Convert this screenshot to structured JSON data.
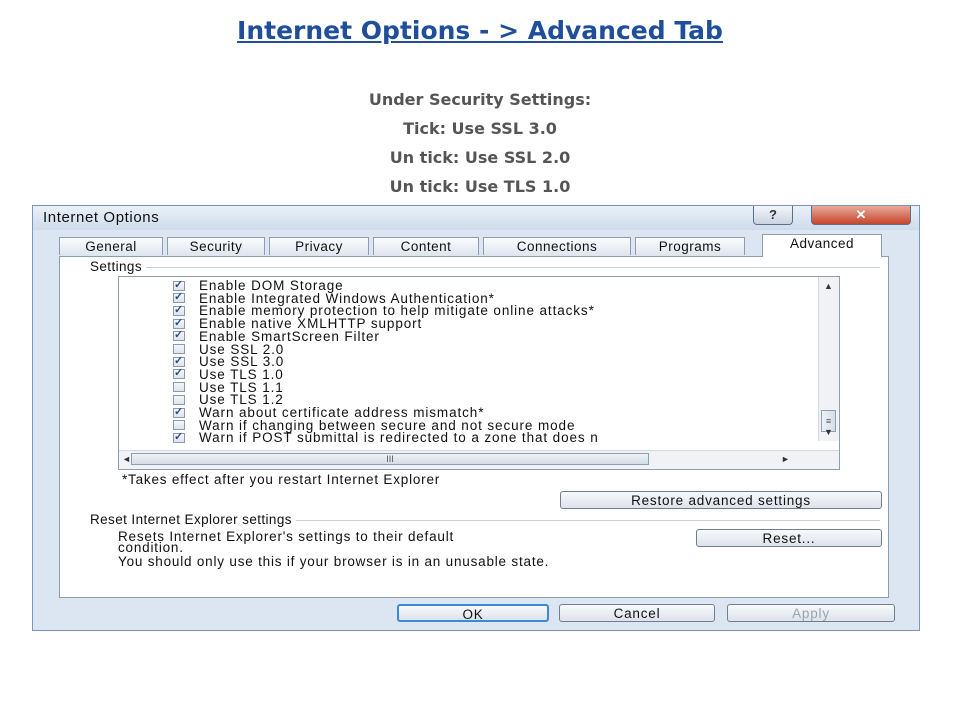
{
  "slide": {
    "title": "Internet Options  - >  Advanced Tab",
    "instructions": [
      "Under Security Settings:",
      "Tick: Use SSL 3.0",
      "Un tick: Use SSL 2.0",
      "Un tick: Use TLS 1.0"
    ]
  },
  "dialog": {
    "title": "Internet Options",
    "help_label": "?",
    "close_label": "✕",
    "tabs": [
      "General",
      "Security",
      "Privacy",
      "Content",
      "Connections",
      "Programs",
      "Advanced"
    ],
    "active_tab": "Advanced",
    "settings_label": "Settings",
    "settings_items": [
      {
        "label": "Enable DOM Storage",
        "checked": true
      },
      {
        "label": "Enable Integrated Windows Authentication*",
        "checked": true
      },
      {
        "label": "Enable memory protection to help mitigate online attacks*",
        "checked": true
      },
      {
        "label": "Enable native XMLHTTP support",
        "checked": true
      },
      {
        "label": "Enable SmartScreen Filter",
        "checked": true
      },
      {
        "label": "Use SSL 2.0",
        "checked": false
      },
      {
        "label": "Use SSL 3.0",
        "checked": true
      },
      {
        "label": "Use TLS 1.0",
        "checked": true
      },
      {
        "label": "Use TLS 1.1",
        "checked": false
      },
      {
        "label": "Use TLS 1.2",
        "checked": false
      },
      {
        "label": "Warn about certificate address mismatch*",
        "checked": true
      },
      {
        "label": "Warn if changing between secure and not secure mode",
        "checked": false
      },
      {
        "label": "Warn if POST submittal is redirected to a zone that does n",
        "checked": true
      }
    ],
    "restart_note": "*Takes effect after you restart Internet Explorer",
    "restore_button": "Restore advanced settings",
    "reset_group_label": "Reset Internet Explorer settings",
    "reset_desc_line1": "Resets Internet Explorer's settings to their default",
    "reset_desc_line2": "condition.",
    "reset_button": "Reset...",
    "reset_warning": "You should only use this if your browser is in an unusable state.",
    "ok_button": "OK",
    "cancel_button": "Cancel",
    "apply_button": "Apply",
    "scroll_glyph_up": "▲",
    "scroll_glyph_down": "▼",
    "scroll_glyph_left": "◄",
    "scroll_glyph_right": "►",
    "grip_v": "≡",
    "grip_h": "III"
  }
}
